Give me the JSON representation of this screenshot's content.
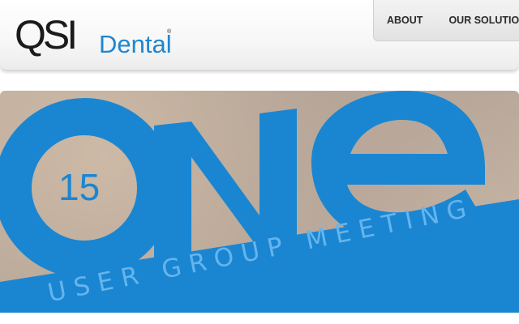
{
  "header": {
    "logo": {
      "primary": "QSI",
      "secondary": "Dental",
      "registered": "®"
    },
    "nav": [
      {
        "label": "ABOUT"
      },
      {
        "label": "OUR SOLUTION"
      }
    ]
  },
  "banner": {
    "headline": "ONE",
    "year": "15",
    "subtitle": "USER GROUP MEETING",
    "accent_color": "#1a86d2"
  }
}
